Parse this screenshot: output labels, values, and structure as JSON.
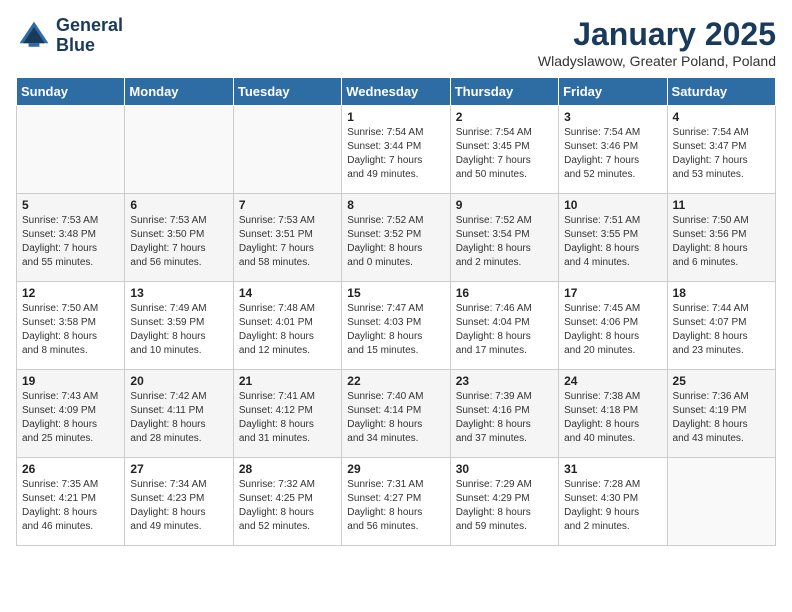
{
  "logo": {
    "line1": "General",
    "line2": "Blue"
  },
  "title": "January 2025",
  "subtitle": "Wladyslawow, Greater Poland, Poland",
  "days_of_week": [
    "Sunday",
    "Monday",
    "Tuesday",
    "Wednesday",
    "Thursday",
    "Friday",
    "Saturday"
  ],
  "weeks": [
    [
      {
        "num": "",
        "info": ""
      },
      {
        "num": "",
        "info": ""
      },
      {
        "num": "",
        "info": ""
      },
      {
        "num": "1",
        "info": "Sunrise: 7:54 AM\nSunset: 3:44 PM\nDaylight: 7 hours\nand 49 minutes."
      },
      {
        "num": "2",
        "info": "Sunrise: 7:54 AM\nSunset: 3:45 PM\nDaylight: 7 hours\nand 50 minutes."
      },
      {
        "num": "3",
        "info": "Sunrise: 7:54 AM\nSunset: 3:46 PM\nDaylight: 7 hours\nand 52 minutes."
      },
      {
        "num": "4",
        "info": "Sunrise: 7:54 AM\nSunset: 3:47 PM\nDaylight: 7 hours\nand 53 minutes."
      }
    ],
    [
      {
        "num": "5",
        "info": "Sunrise: 7:53 AM\nSunset: 3:48 PM\nDaylight: 7 hours\nand 55 minutes."
      },
      {
        "num": "6",
        "info": "Sunrise: 7:53 AM\nSunset: 3:50 PM\nDaylight: 7 hours\nand 56 minutes."
      },
      {
        "num": "7",
        "info": "Sunrise: 7:53 AM\nSunset: 3:51 PM\nDaylight: 7 hours\nand 58 minutes."
      },
      {
        "num": "8",
        "info": "Sunrise: 7:52 AM\nSunset: 3:52 PM\nDaylight: 8 hours\nand 0 minutes."
      },
      {
        "num": "9",
        "info": "Sunrise: 7:52 AM\nSunset: 3:54 PM\nDaylight: 8 hours\nand 2 minutes."
      },
      {
        "num": "10",
        "info": "Sunrise: 7:51 AM\nSunset: 3:55 PM\nDaylight: 8 hours\nand 4 minutes."
      },
      {
        "num": "11",
        "info": "Sunrise: 7:50 AM\nSunset: 3:56 PM\nDaylight: 8 hours\nand 6 minutes."
      }
    ],
    [
      {
        "num": "12",
        "info": "Sunrise: 7:50 AM\nSunset: 3:58 PM\nDaylight: 8 hours\nand 8 minutes."
      },
      {
        "num": "13",
        "info": "Sunrise: 7:49 AM\nSunset: 3:59 PM\nDaylight: 8 hours\nand 10 minutes."
      },
      {
        "num": "14",
        "info": "Sunrise: 7:48 AM\nSunset: 4:01 PM\nDaylight: 8 hours\nand 12 minutes."
      },
      {
        "num": "15",
        "info": "Sunrise: 7:47 AM\nSunset: 4:03 PM\nDaylight: 8 hours\nand 15 minutes."
      },
      {
        "num": "16",
        "info": "Sunrise: 7:46 AM\nSunset: 4:04 PM\nDaylight: 8 hours\nand 17 minutes."
      },
      {
        "num": "17",
        "info": "Sunrise: 7:45 AM\nSunset: 4:06 PM\nDaylight: 8 hours\nand 20 minutes."
      },
      {
        "num": "18",
        "info": "Sunrise: 7:44 AM\nSunset: 4:07 PM\nDaylight: 8 hours\nand 23 minutes."
      }
    ],
    [
      {
        "num": "19",
        "info": "Sunrise: 7:43 AM\nSunset: 4:09 PM\nDaylight: 8 hours\nand 25 minutes."
      },
      {
        "num": "20",
        "info": "Sunrise: 7:42 AM\nSunset: 4:11 PM\nDaylight: 8 hours\nand 28 minutes."
      },
      {
        "num": "21",
        "info": "Sunrise: 7:41 AM\nSunset: 4:12 PM\nDaylight: 8 hours\nand 31 minutes."
      },
      {
        "num": "22",
        "info": "Sunrise: 7:40 AM\nSunset: 4:14 PM\nDaylight: 8 hours\nand 34 minutes."
      },
      {
        "num": "23",
        "info": "Sunrise: 7:39 AM\nSunset: 4:16 PM\nDaylight: 8 hours\nand 37 minutes."
      },
      {
        "num": "24",
        "info": "Sunrise: 7:38 AM\nSunset: 4:18 PM\nDaylight: 8 hours\nand 40 minutes."
      },
      {
        "num": "25",
        "info": "Sunrise: 7:36 AM\nSunset: 4:19 PM\nDaylight: 8 hours\nand 43 minutes."
      }
    ],
    [
      {
        "num": "26",
        "info": "Sunrise: 7:35 AM\nSunset: 4:21 PM\nDaylight: 8 hours\nand 46 minutes."
      },
      {
        "num": "27",
        "info": "Sunrise: 7:34 AM\nSunset: 4:23 PM\nDaylight: 8 hours\nand 49 minutes."
      },
      {
        "num": "28",
        "info": "Sunrise: 7:32 AM\nSunset: 4:25 PM\nDaylight: 8 hours\nand 52 minutes."
      },
      {
        "num": "29",
        "info": "Sunrise: 7:31 AM\nSunset: 4:27 PM\nDaylight: 8 hours\nand 56 minutes."
      },
      {
        "num": "30",
        "info": "Sunrise: 7:29 AM\nSunset: 4:29 PM\nDaylight: 8 hours\nand 59 minutes."
      },
      {
        "num": "31",
        "info": "Sunrise: 7:28 AM\nSunset: 4:30 PM\nDaylight: 9 hours\nand 2 minutes."
      },
      {
        "num": "",
        "info": ""
      }
    ]
  ]
}
